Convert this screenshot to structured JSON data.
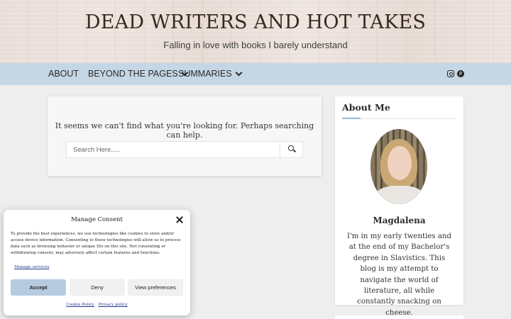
{
  "header": {
    "site_title": "DEAD WRITERS AND HOT TAKES",
    "tagline": "Falling in love with books I barely understand"
  },
  "nav": {
    "items": [
      {
        "label": "ABOUT",
        "has_dropdown": false
      },
      {
        "label": "BEYOND THE PAGES",
        "has_dropdown": true
      },
      {
        "label": "SUMMARIES",
        "has_dropdown": true
      }
    ],
    "social_icons": [
      "instagram-icon",
      "pinterest-icon"
    ],
    "background_color": "#c5d6e4"
  },
  "main": {
    "not_found_message": "It seems we can't find what you're looking for. Perhaps searching can help.",
    "search": {
      "placeholder": "Search Here.....",
      "value": "",
      "button_icon": "search-icon"
    }
  },
  "sidebar": {
    "about_title": "About Me",
    "author_name": "Magdalena",
    "bio": "I'm in my early twenties and at the end of my Bachelor's degree in Slavistics. This blog is my attempt to navigate the world of literature, all while constantly snacking on cheese."
  },
  "consent": {
    "title": "Manage Consent",
    "body": "To provide the best experiences, we use technologies like cookies to store and/or access device information. Consenting to these technologies will allow us to process data such as browsing behavior or unique IDs on this site. Not consenting or withdrawing consent, may adversely affect certain features and functions.",
    "manage_services": "Manage services",
    "accept_label": "Accept",
    "deny_label": "Deny",
    "preferences_label": "View preferences",
    "cookie_policy": "Cookie Policy",
    "privacy_policy": "Privacy policy",
    "accent_color": "#b6cbe0"
  }
}
